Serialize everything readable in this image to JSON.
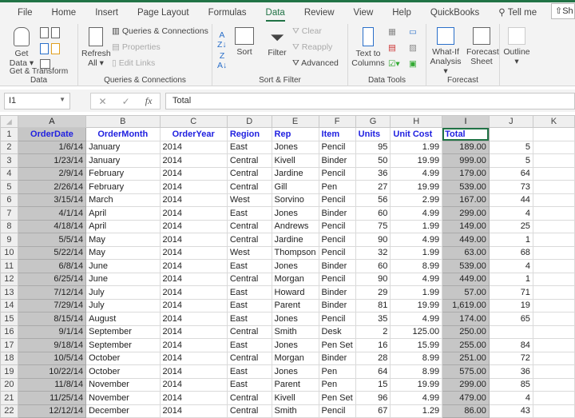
{
  "tabs": [
    "File",
    "Home",
    "Insert",
    "Page Layout",
    "Formulas",
    "Data",
    "Review",
    "View",
    "Help",
    "QuickBooks",
    "Tell me"
  ],
  "active_tab": "Data",
  "share_label": "Sh",
  "ribbon": {
    "get_transform": {
      "label": "Get & Transform Data",
      "get_data": "Get Data"
    },
    "queries": {
      "label": "Queries & Connections",
      "refresh": "Refresh All",
      "queries_connections": "Queries & Connections",
      "properties": "Properties",
      "edit_links": "Edit Links"
    },
    "sort_filter": {
      "label": "Sort & Filter",
      "sort": "Sort",
      "filter": "Filter",
      "clear": "Clear",
      "reapply": "Reapply",
      "advanced": "Advanced"
    },
    "data_tools": {
      "label": "Data Tools",
      "text_to_columns": "Text to Columns"
    },
    "forecast": {
      "label": "Forecast",
      "what_if": "What-If Analysis",
      "forecast_sheet": "Forecast Sheet"
    },
    "outline": {
      "label": "Outline"
    }
  },
  "formula_bar": {
    "name_box": "I1",
    "formula": "Total"
  },
  "columns": [
    "A",
    "B",
    "C",
    "D",
    "E",
    "F",
    "G",
    "H",
    "I",
    "J",
    "K"
  ],
  "headers": [
    "OrderDate",
    "OrderMonth",
    "OrderYear",
    "Region",
    "Rep",
    "Item",
    "Units",
    "Unit Cost",
    "Total"
  ],
  "rows": [
    [
      "1/6/14",
      "January",
      "2014",
      "East",
      "Jones",
      "Pencil",
      "95",
      "1.99",
      "189.00",
      "5"
    ],
    [
      "1/23/14",
      "January",
      "2014",
      "Central",
      "Kivell",
      "Binder",
      "50",
      "19.99",
      "999.00",
      "5"
    ],
    [
      "2/9/14",
      "February",
      "2014",
      "Central",
      "Jardine",
      "Pencil",
      "36",
      "4.99",
      "179.00",
      "64"
    ],
    [
      "2/26/14",
      "February",
      "2014",
      "Central",
      "Gill",
      "Pen",
      "27",
      "19.99",
      "539.00",
      "73"
    ],
    [
      "3/15/14",
      "March",
      "2014",
      "West",
      "Sorvino",
      "Pencil",
      "56",
      "2.99",
      "167.00",
      "44"
    ],
    [
      "4/1/14",
      "April",
      "2014",
      "East",
      "Jones",
      "Binder",
      "60",
      "4.99",
      "299.00",
      "4"
    ],
    [
      "4/18/14",
      "April",
      "2014",
      "Central",
      "Andrews",
      "Pencil",
      "75",
      "1.99",
      "149.00",
      "25"
    ],
    [
      "5/5/14",
      "May",
      "2014",
      "Central",
      "Jardine",
      "Pencil",
      "90",
      "4.99",
      "449.00",
      "1"
    ],
    [
      "5/22/14",
      "May",
      "2014",
      "West",
      "Thompson",
      "Pencil",
      "32",
      "1.99",
      "63.00",
      "68"
    ],
    [
      "6/8/14",
      "June",
      "2014",
      "East",
      "Jones",
      "Binder",
      "60",
      "8.99",
      "539.00",
      "4"
    ],
    [
      "6/25/14",
      "June",
      "2014",
      "Central",
      "Morgan",
      "Pencil",
      "90",
      "4.99",
      "449.00",
      "1"
    ],
    [
      "7/12/14",
      "July",
      "2014",
      "East",
      "Howard",
      "Binder",
      "29",
      "1.99",
      "57.00",
      "71"
    ],
    [
      "7/29/14",
      "July",
      "2014",
      "East",
      "Parent",
      "Binder",
      "81",
      "19.99",
      "1,619.00",
      "19"
    ],
    [
      "8/15/14",
      "August",
      "2014",
      "East",
      "Jones",
      "Pencil",
      "35",
      "4.99",
      "174.00",
      "65"
    ],
    [
      "9/1/14",
      "September",
      "2014",
      "Central",
      "Smith",
      "Desk",
      "2",
      "125.00",
      "250.00",
      ""
    ],
    [
      "9/18/14",
      "September",
      "2014",
      "East",
      "Jones",
      "Pen Set",
      "16",
      "15.99",
      "255.00",
      "84"
    ],
    [
      "10/5/14",
      "October",
      "2014",
      "Central",
      "Morgan",
      "Binder",
      "28",
      "8.99",
      "251.00",
      "72"
    ],
    [
      "10/22/14",
      "October",
      "2014",
      "East",
      "Jones",
      "Pen",
      "64",
      "8.99",
      "575.00",
      "36"
    ],
    [
      "11/8/14",
      "November",
      "2014",
      "East",
      "Parent",
      "Pen",
      "15",
      "19.99",
      "299.00",
      "85"
    ],
    [
      "11/25/14",
      "November",
      "2014",
      "Central",
      "Kivell",
      "Pen Set",
      "96",
      "4.99",
      "479.00",
      "4"
    ],
    [
      "12/12/14",
      "December",
      "2014",
      "Central",
      "Smith",
      "Pencil",
      "67",
      "1.29",
      "86.00",
      "43"
    ]
  ],
  "colors": {
    "accent": "#217346",
    "header_text": "#2020e0",
    "selected_fill": "#c6c6c6"
  }
}
